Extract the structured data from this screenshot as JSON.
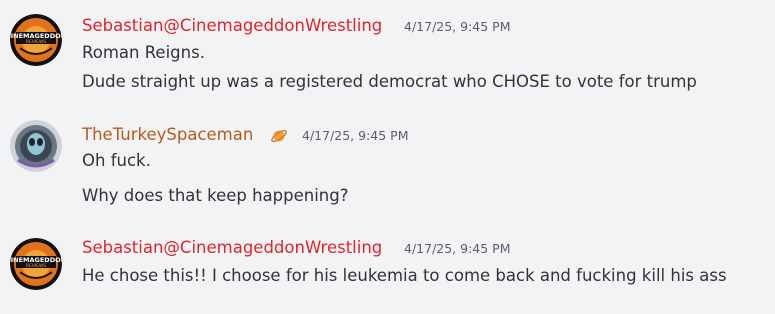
{
  "colors": {
    "background": "#f2f3f5",
    "text": "#313338",
    "timestamp": "#5c5e66",
    "username_sebastian": "#e0242a",
    "username_turkey": "#b85a1c"
  },
  "messages": [
    {
      "author": "Sebastian@CinemageddonWrestling",
      "avatar_icon": "cinemageddon-logo-icon",
      "timestamp": "4/17/25, 9:45 PM",
      "lines": [
        "Roman Reigns.",
        "Dude straight up was a registered democrat who CHOSE to vote for trump"
      ]
    },
    {
      "author": "TheTurkeySpaceman",
      "avatar_icon": "alien-helmet-avatar-icon",
      "badge_icon": "planet-badge-icon",
      "timestamp": "4/17/25, 9:45 PM",
      "lines": [
        "Oh fuck.",
        "Why does that keep happening?"
      ]
    },
    {
      "author": "Sebastian@CinemageddonWrestling",
      "avatar_icon": "cinemageddon-logo-icon",
      "timestamp": "4/17/25, 9:45 PM",
      "lines": [
        "He chose this!! I choose for his leukemia to come back and fucking kill his ass"
      ]
    }
  ]
}
